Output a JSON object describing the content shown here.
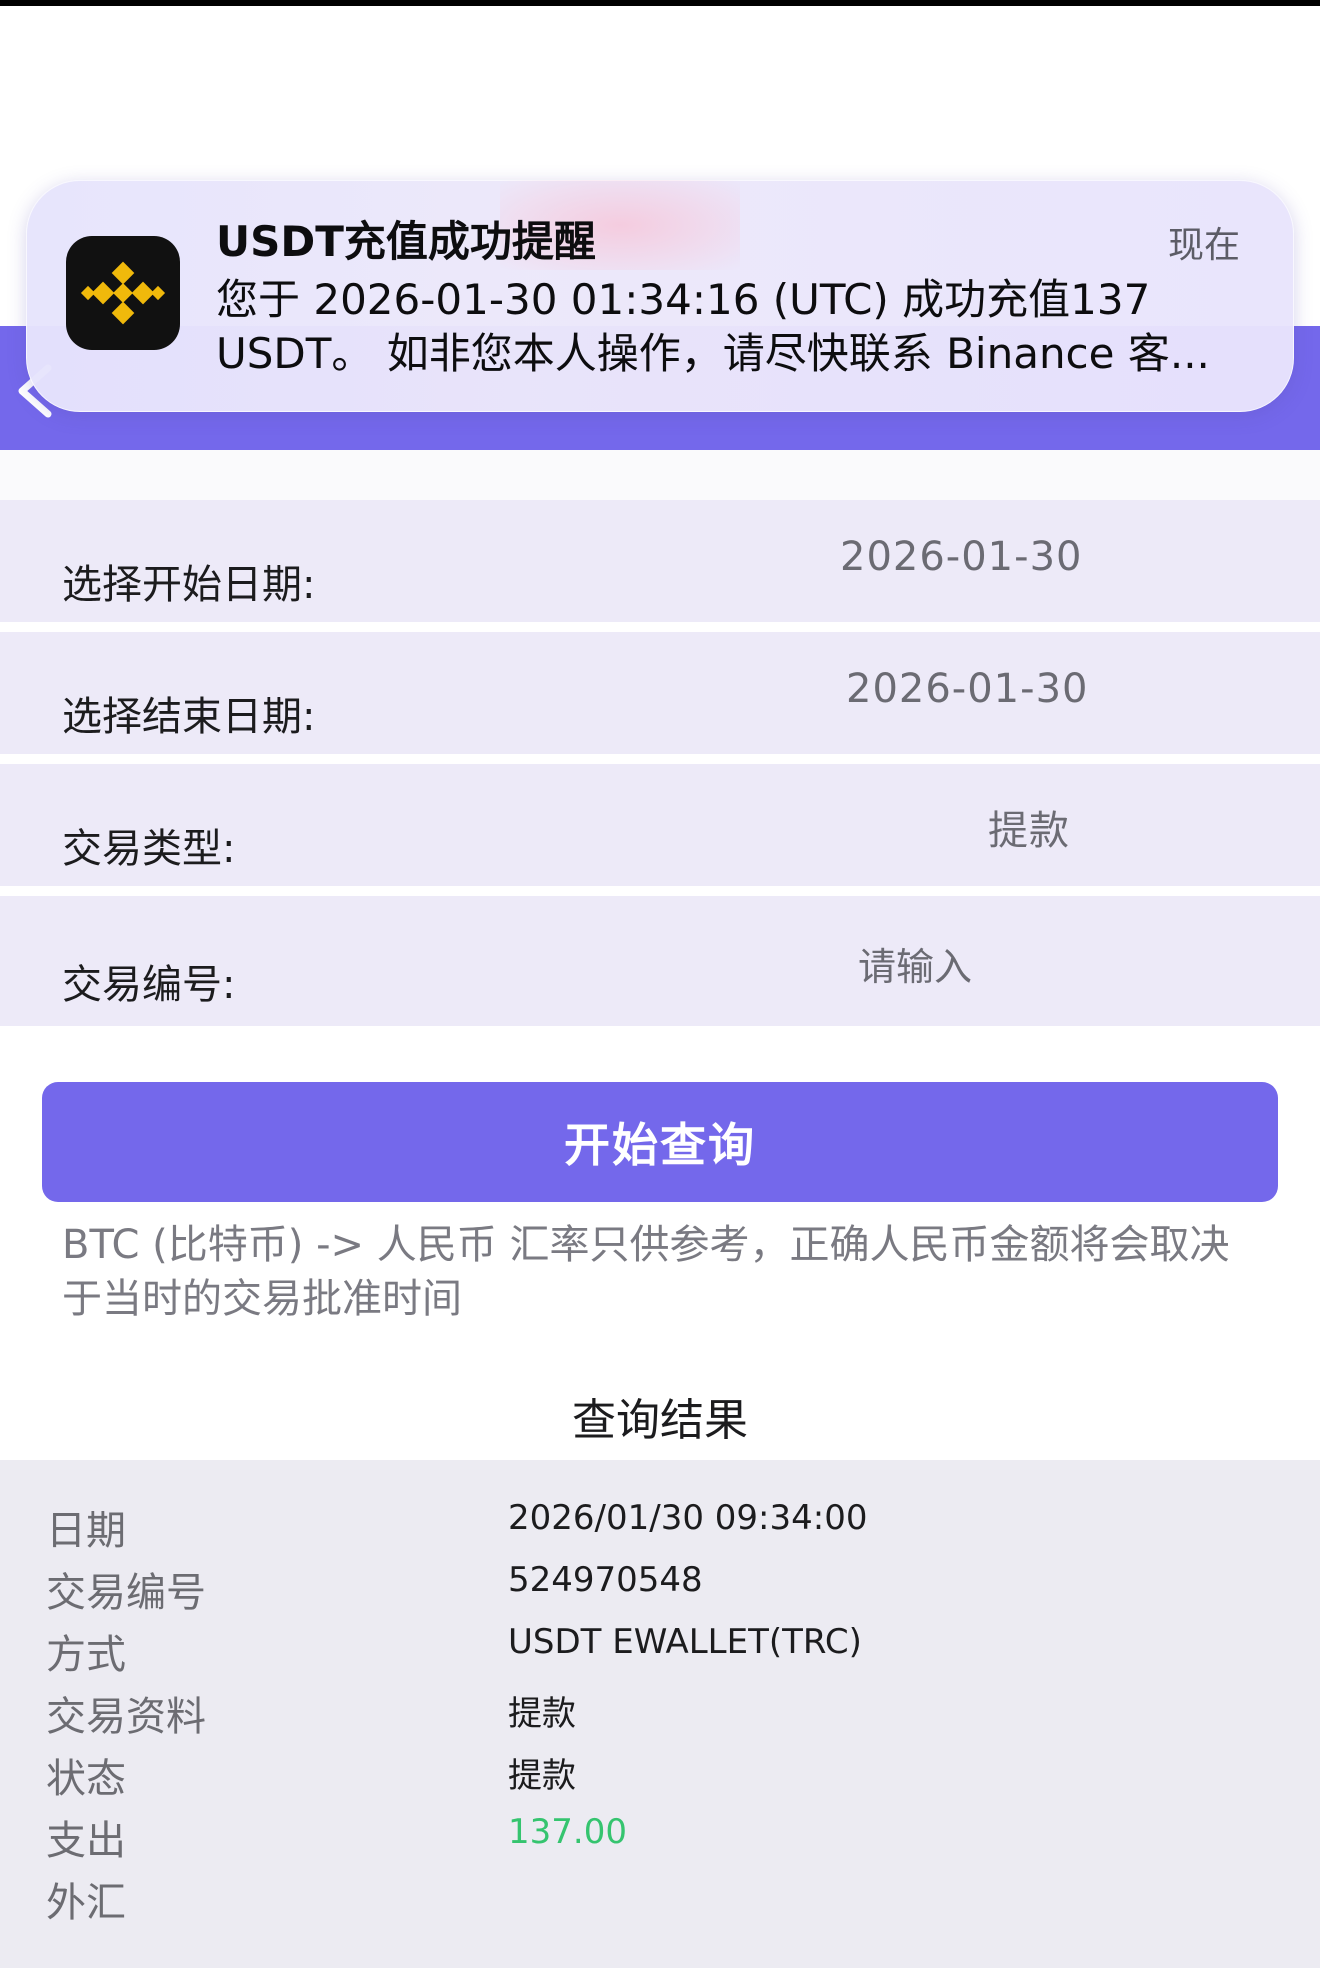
{
  "notification": {
    "title": "USDT充值成功提醒",
    "time": "现在",
    "line1": "您于 2026-01-30 01:34:16 (UTC) 成功充值137",
    "line2": "USDT。 如非您本人操作，请尽快联系 Binance 客...",
    "app_icon": "binance-logo-icon"
  },
  "header": {
    "back_icon": "chevron-left-icon"
  },
  "form": {
    "start_date": {
      "label": "选择开始日期:",
      "value": "2026-01-30"
    },
    "end_date": {
      "label": "选择结束日期:",
      "value": "2026-01-30"
    },
    "type": {
      "label": "交易类型:",
      "value": "提款"
    },
    "txn_id": {
      "label": "交易编号:",
      "placeholder": "请输入"
    }
  },
  "query_button": "开始查询",
  "note": "BTC (比特币) -> 人民币 汇率只供参考，正确人民币金额将会取决于当时的交易批准时间",
  "results": {
    "title": "查询结果",
    "rows": [
      {
        "label": "日期",
        "value": "2026/01/30 09:34:00"
      },
      {
        "label": "交易编号",
        "value": "524970548"
      },
      {
        "label": "方式",
        "value": "USDT EWALLET(TRC)"
      },
      {
        "label": "交易资料",
        "value": "提款"
      },
      {
        "label": "状态",
        "value": "提款"
      },
      {
        "label": "支出",
        "value": "137.00"
      },
      {
        "label": "外汇",
        "value": ""
      }
    ]
  },
  "colors": {
    "accent": "#7468eb",
    "row_bg": "#edeaf8",
    "amount": "#35c46f"
  }
}
